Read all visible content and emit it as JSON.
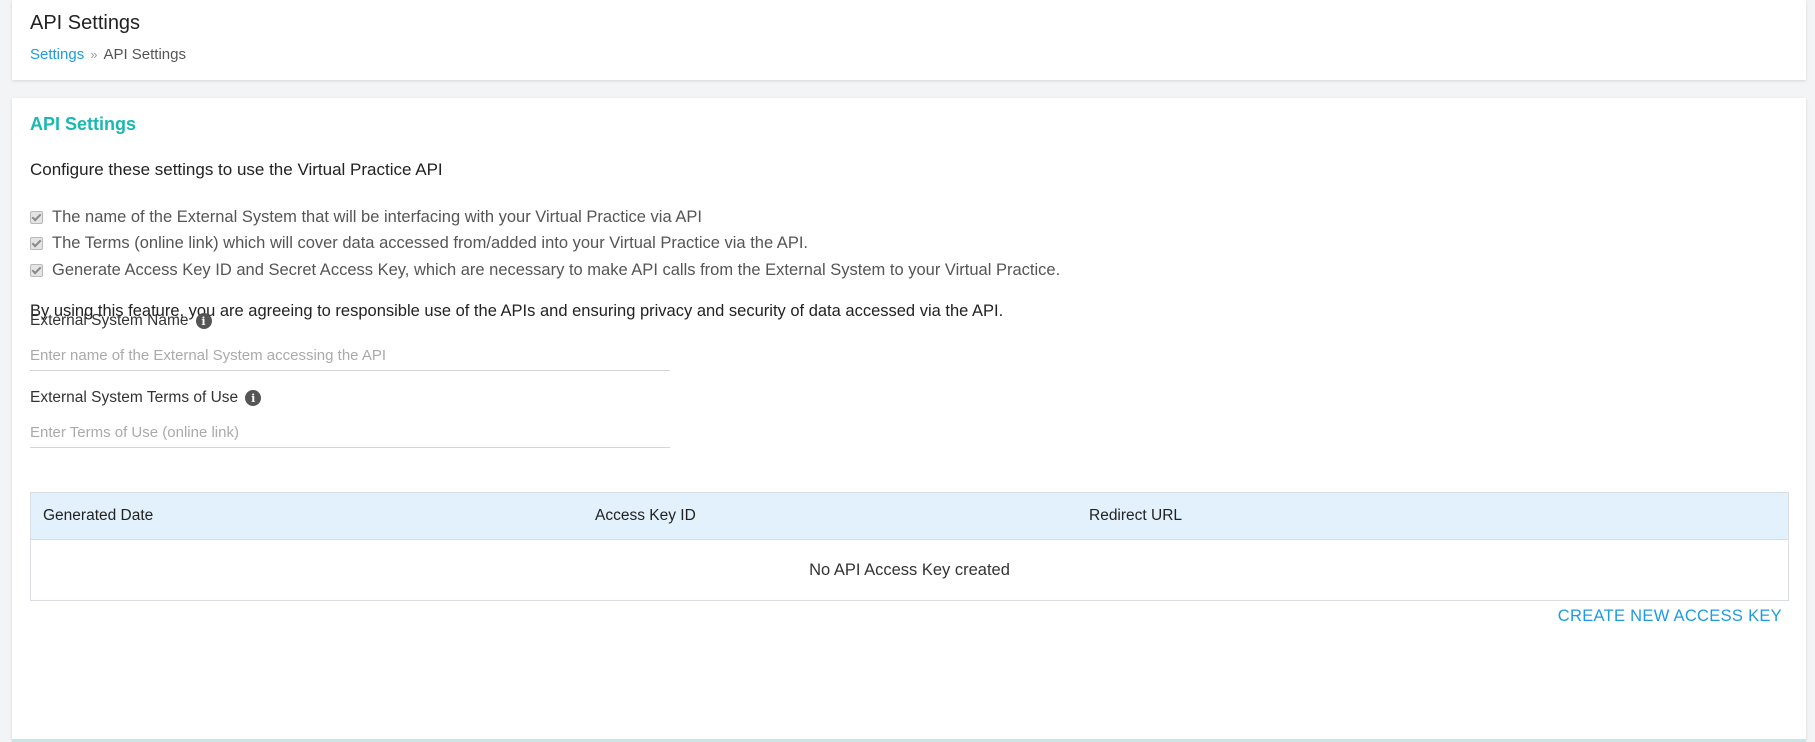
{
  "header": {
    "title": "API Settings",
    "breadcrumb": {
      "parent": "Settings",
      "separator": "»",
      "current": "API Settings"
    }
  },
  "main": {
    "section_title": "API Settings",
    "intro": "Configure these settings to use the Virtual Practice API",
    "checklist": [
      "The name of the External System that will be interfacing with your Virtual Practice via API",
      "The Terms (online link) which will cover data accessed from/added into your Virtual Practice via the API.",
      "Generate Access Key ID and Secret Access Key, which are necessary to make API calls from the External System to your Virtual Practice."
    ],
    "disclaimer": "By using this feature, you are agreeing to responsible use of the APIs and ensuring privacy and security of data accessed via the API.",
    "fields": {
      "system_name": {
        "label": "External System Name",
        "placeholder": "Enter name of the External System accessing the API",
        "value": ""
      },
      "terms": {
        "label": "External System Terms of Use",
        "placeholder": "Enter Terms of Use (online link)",
        "value": ""
      }
    },
    "table": {
      "columns": [
        "Generated Date",
        "Access Key ID",
        "Redirect URL"
      ],
      "empty_message": "No API Access Key created"
    },
    "create_button": "CREATE NEW ACCESS KEY"
  },
  "icons": {
    "info": "info-icon",
    "checkbox": "checkbox-checked-disabled"
  },
  "colors": {
    "accent_teal": "#19b8b0",
    "link_blue": "#1f9ae0",
    "table_header_bg": "#e3f1fc"
  }
}
